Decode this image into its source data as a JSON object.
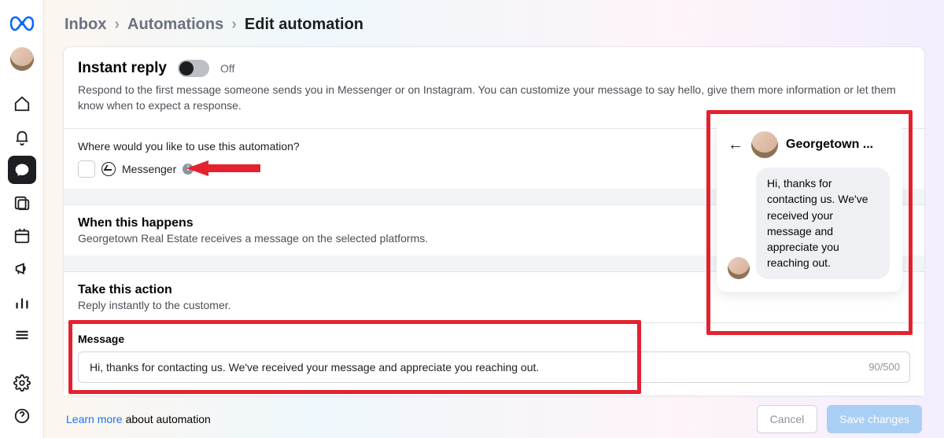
{
  "breadcrumb": {
    "a": "Inbox",
    "b": "Automations",
    "c": "Edit automation"
  },
  "header": {
    "title": "Instant reply",
    "toggle_off": "Off",
    "description": "Respond to the first message someone sends you in Messenger or on Instagram. You can customize your message to say hello, give them more information or let them know when to expect a response."
  },
  "channel": {
    "question": "Where would you like to use this automation?",
    "option": "Messenger"
  },
  "when": {
    "title": "When this happens",
    "sub": "Georgetown Real Estate receives a message on the selected platforms."
  },
  "action": {
    "title": "Take this action",
    "sub": "Reply instantly to the customer."
  },
  "message": {
    "label": "Message",
    "value": "Hi, thanks for contacting us. We've received your message and appreciate you reaching out.",
    "counter": "90/500"
  },
  "preview": {
    "name": "Georgetown ...",
    "bubble": "Hi, thanks for contacting us. We've received your message and appreciate you reaching out."
  },
  "footer": {
    "link": "Learn more",
    "tail": " about automation",
    "cancel": "Cancel",
    "save": "Save changes"
  }
}
